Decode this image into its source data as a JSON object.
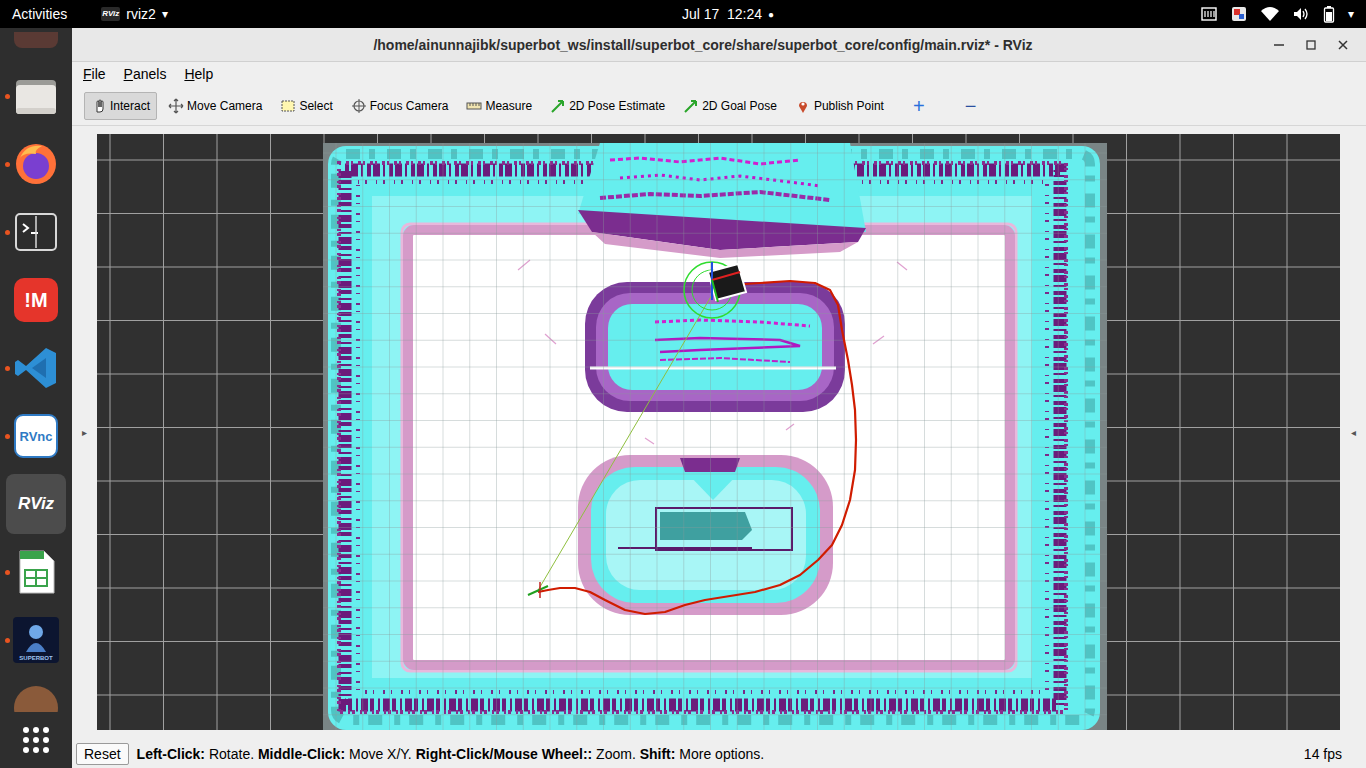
{
  "top_bar": {
    "activities": "Activities",
    "app_icon": "RViz",
    "app_name": "rviz2",
    "app_arrow": "▾",
    "clock": "Jul 17  12:24",
    "notification_dot": "●",
    "system_arrow": "▾"
  },
  "dock": {
    "items": [
      {
        "glyph": "",
        "running": true,
        "selected": false
      },
      {
        "glyph": "",
        "running": true,
        "selected": false
      },
      {
        "glyph": "",
        "running": true,
        "selected": false
      },
      {
        "glyph": "!M",
        "running": false,
        "selected": false
      },
      {
        "glyph": "",
        "running": true,
        "selected": false
      },
      {
        "glyph": "RVnc",
        "running": true,
        "selected": false
      },
      {
        "glyph": "RViz",
        "running": false,
        "selected": true
      },
      {
        "glyph": "",
        "running": true,
        "selected": false
      },
      {
        "glyph": "SUPERBOT",
        "running": true,
        "selected": false
      }
    ]
  },
  "window": {
    "title": "/home/ainunnajibk/superbot_ws/install/superbot_core/share/superbot_core/config/main.rviz* - RViz"
  },
  "menu": [
    {
      "label": "File"
    },
    {
      "label": "Panels"
    },
    {
      "label": "Help"
    }
  ],
  "toolbar": {
    "tools": [
      {
        "label": "Interact",
        "selected": true
      },
      {
        "label": "Move Camera",
        "selected": false
      },
      {
        "label": "Select",
        "selected": false
      },
      {
        "label": "Focus Camera",
        "selected": false
      },
      {
        "label": "Measure",
        "selected": false
      },
      {
        "label": "2D Pose Estimate",
        "selected": false
      },
      {
        "label": "2D Goal Pose",
        "selected": false
      },
      {
        "label": "Publish Point",
        "selected": false
      }
    ],
    "extra": [
      "+",
      "−"
    ]
  },
  "handles": {
    "left": "▸",
    "right": "◂"
  },
  "status_bar": {
    "reset": "Reset",
    "hints": [
      {
        "text": "Left-Click:",
        "bold": true
      },
      {
        "text": " Rotate. ",
        "bold": false
      },
      {
        "text": "Middle-Click:",
        "bold": true
      },
      {
        "text": " Move X/Y. ",
        "bold": false
      },
      {
        "text": "Right-Click/Mouse Wheel::",
        "bold": true
      },
      {
        "text": " Zoom. ",
        "bold": false
      },
      {
        "text": "Shift:",
        "bold": true
      },
      {
        "text": " More options.",
        "bold": false
      }
    ],
    "fps": "14 fps"
  }
}
